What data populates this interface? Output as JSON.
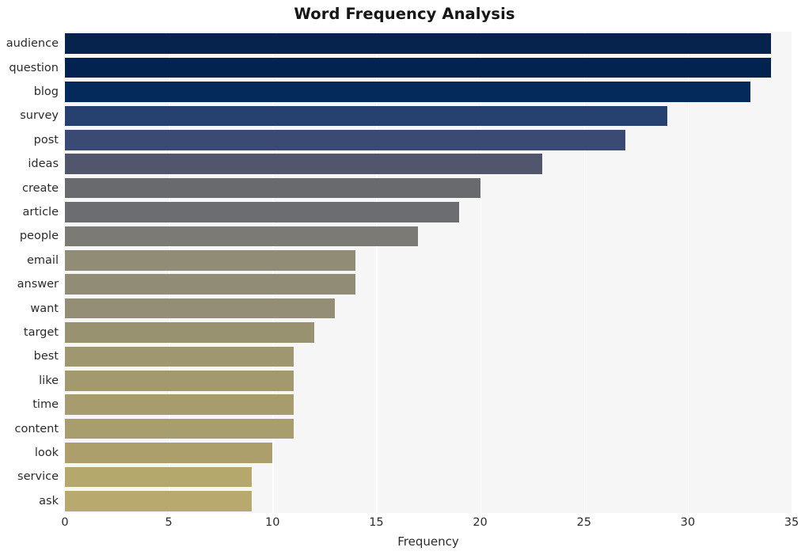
{
  "chart_data": {
    "type": "bar",
    "orientation": "horizontal",
    "title": "Word Frequency Analysis",
    "xlabel": "Frequency",
    "ylabel": "",
    "categories": [
      "audience",
      "question",
      "blog",
      "survey",
      "post",
      "ideas",
      "create",
      "article",
      "people",
      "email",
      "answer",
      "want",
      "target",
      "best",
      "like",
      "time",
      "content",
      "look",
      "service",
      "ask"
    ],
    "values": [
      34,
      34,
      33,
      29,
      27,
      23,
      20,
      19,
      17,
      14,
      14,
      13,
      12,
      11,
      11,
      11,
      11,
      10,
      9,
      9
    ],
    "bar_colors": [
      "#05234d",
      "#02234f",
      "#042a5c",
      "#26406f",
      "#3a4a72",
      "#51566d",
      "#686a6e",
      "#6c6d70",
      "#7b7a75",
      "#918c76",
      "#918c76",
      "#938e75",
      "#999271",
      "#9f976f",
      "#a3996e",
      "#a69c6e",
      "#a89d6d",
      "#ac9f6c",
      "#b4a86d",
      "#b8aa6e"
    ],
    "xlim": [
      0,
      35
    ],
    "x_ticks": [
      0,
      5,
      10,
      15,
      20,
      25,
      30,
      35
    ],
    "x_tick_labels": [
      "0",
      "5",
      "10",
      "15",
      "20",
      "25",
      "30",
      "35"
    ],
    "grid": true,
    "grid_axis": "x",
    "grid_color": "#ffffff",
    "plot_background": "#f6f6f7",
    "figure_background": "#ffffff",
    "legend": null,
    "legend_position": "none"
  }
}
